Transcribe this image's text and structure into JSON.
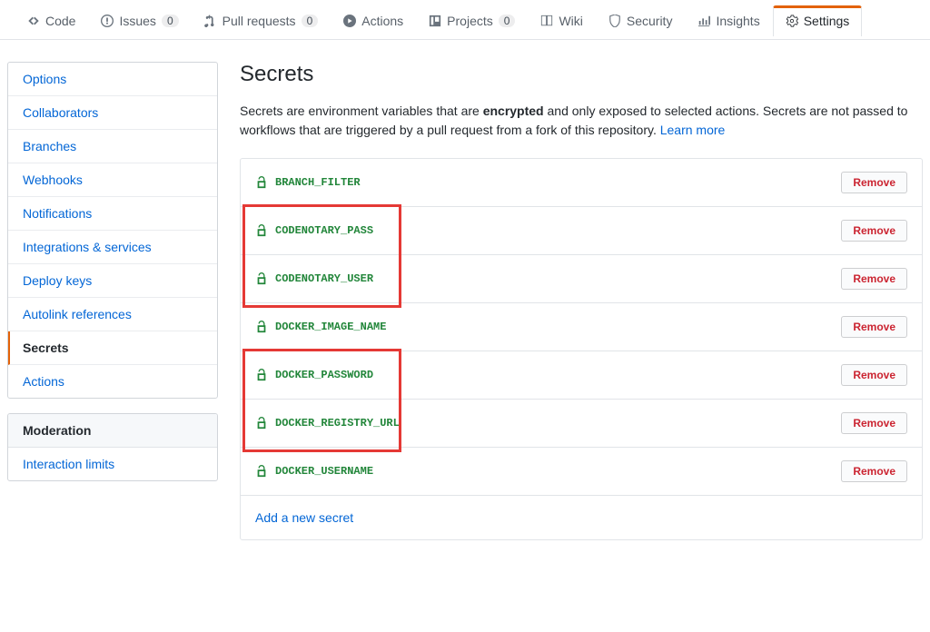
{
  "reponav": {
    "code": "Code",
    "issues": "Issues",
    "issues_count": "0",
    "pulls": "Pull requests",
    "pulls_count": "0",
    "actions": "Actions",
    "projects": "Projects",
    "projects_count": "0",
    "wiki": "Wiki",
    "security": "Security",
    "insights": "Insights",
    "settings": "Settings"
  },
  "sidebar": {
    "items": [
      "Options",
      "Collaborators",
      "Branches",
      "Webhooks",
      "Notifications",
      "Integrations & services",
      "Deploy keys",
      "Autolink references",
      "Secrets",
      "Actions"
    ],
    "moderation_heading": "Moderation",
    "moderation_items": [
      "Interaction limits"
    ]
  },
  "page": {
    "title": "Secrets",
    "desc_before": "Secrets are environment variables that are ",
    "desc_bold": "encrypted",
    "desc_after": " and only exposed to selected actions. Secrets are not passed to workflows that are triggered by a pull request from a fork of this repository. ",
    "learn_more": "Learn more"
  },
  "secrets": [
    {
      "name": "BRANCH_FILTER"
    },
    {
      "name": "CODENOTARY_PASS"
    },
    {
      "name": "CODENOTARY_USER"
    },
    {
      "name": "DOCKER_IMAGE_NAME"
    },
    {
      "name": "DOCKER_PASSWORD"
    },
    {
      "name": "DOCKER_REGISTRY_URL"
    },
    {
      "name": "DOCKER_USERNAME"
    }
  ],
  "buttons": {
    "remove": "Remove",
    "add_new": "Add a new secret"
  }
}
